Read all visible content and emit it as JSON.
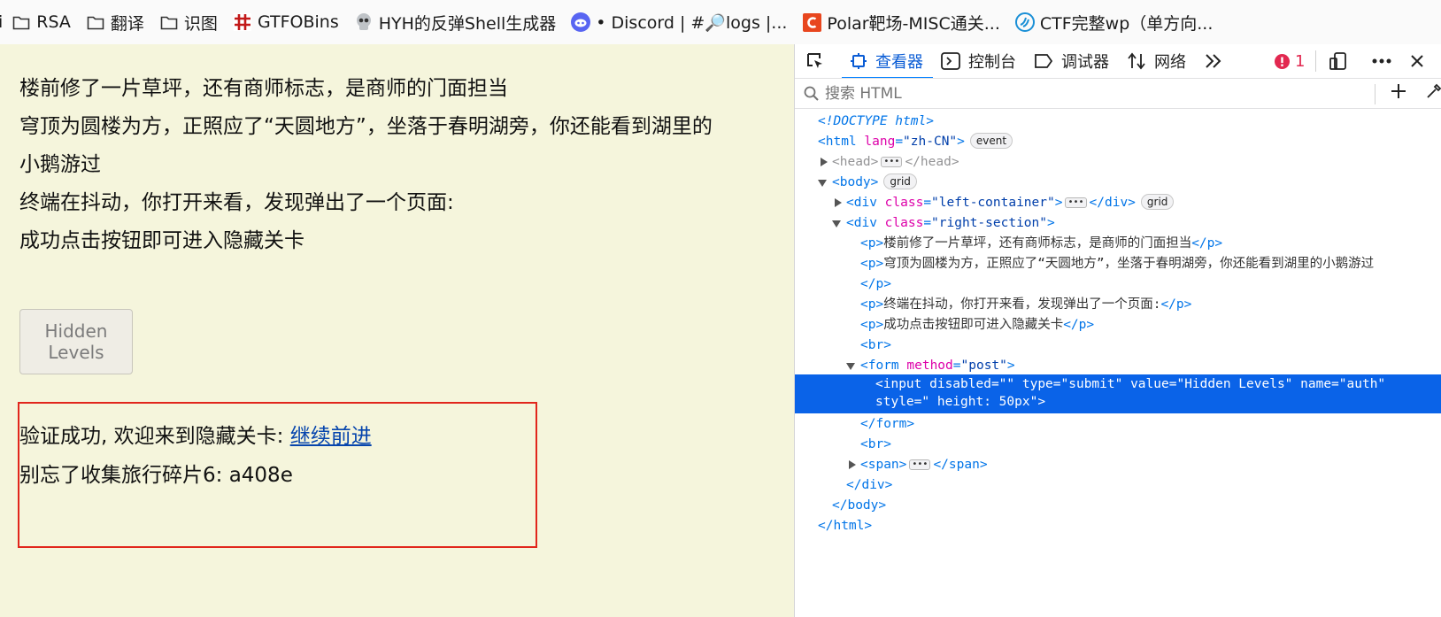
{
  "bookmarks": [
    {
      "label": "i",
      "icon": "none"
    },
    {
      "label": "RSA",
      "icon": "folder-icon"
    },
    {
      "label": "翻译",
      "icon": "folder-icon"
    },
    {
      "label": "识图",
      "icon": "folder-icon"
    },
    {
      "label": "GTFOBins",
      "icon": "gtfobins-icon"
    },
    {
      "label": "HYH的反弹Shell生成器",
      "icon": "skull-icon"
    },
    {
      "label": "• Discord | #🔎logs |...",
      "icon": "discord-icon"
    },
    {
      "label": "Polar靶场-MISC通关...",
      "icon": "polar-icon"
    },
    {
      "label": "CTF完整wp（单方向...",
      "icon": "ctf-icon"
    }
  ],
  "page": {
    "paragraphs": [
      "楼前修了一片草坪，还有商师标志，是商师的门面担当",
      "穹顶为圆楼为方，正照应了“天圆地方”，坐落于春明湖旁，你还能看到湖里的",
      "小鹅游过",
      "终端在抖动，你打开来看，发现弹出了一个页面:",
      "成功点击按钮即可进入隐藏关卡"
    ],
    "button_label": "Hidden Levels",
    "result": {
      "line1_text": "验证成功, 欢迎来到隐藏关卡: ",
      "line1_link": "继续前进",
      "line2": "别忘了收集旅行碎片6: a408e"
    },
    "background": "#f5f5dc",
    "highlight_color": "#e1261c"
  },
  "devtools": {
    "tabs": {
      "inspector": "查看器",
      "console": "控制台",
      "debugger": "调试器",
      "network": "网络"
    },
    "error_count": "1",
    "search_placeholder": "搜索 HTML",
    "markup": {
      "doctype": "<!DOCTYPE html>",
      "html_lang": "\"zh-CN\"",
      "event_badge": "event",
      "grid_badge": "grid",
      "left_container": "\"left-container\"",
      "right_section": "\"right-section\"",
      "p1": "楼前修了一片草坪，还有商师标志，是商师的门面担当",
      "p2": "穹顶为圆楼为方，正照应了“天圆地方”，坐落于春明湖旁，你还能看到湖里的小鹅游过",
      "p3": "终端在抖动，你打开来看，发现弹出了一个页面:",
      "p4": "成功点击按钮即可进入隐藏关卡",
      "form_method": "\"post\"",
      "selected_line1": "<input disabled=\"\" type=\"submit\" value=\"Hidden Levels\" name=\"auth\"",
      "selected_line2": "style=\" height: 50px\">"
    },
    "accent": "#0a63e8"
  }
}
